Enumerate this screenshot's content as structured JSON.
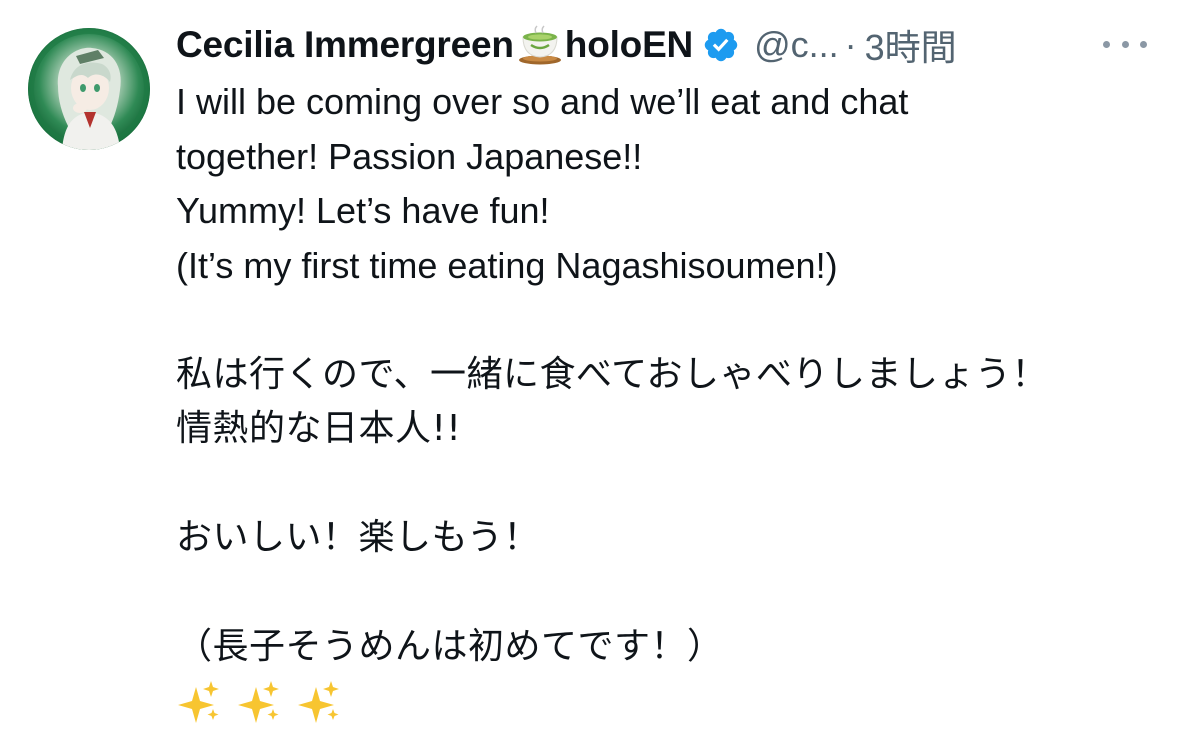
{
  "author": {
    "display_name": "Cecilia Immergreen",
    "name_suffix": "holoEN",
    "name_emoji": "tea-icon",
    "verified": true,
    "verified_color": "#1d9bf0",
    "handle": "@c...",
    "separator": "·",
    "timestamp": "3時間"
  },
  "tweet": {
    "lines": [
      "I will be coming over so and we’ll eat and chat",
      "together! Passion Japanese!!",
      "Yummy! Let’s have fun!",
      "(It’s my first time eating Nagashisoumen!)",
      "",
      "私は行くので、一緒に食べておしゃべりしましょう！",
      "情熱的な日本人!!",
      "",
      "おいしい！楽しもう！",
      "",
      "（長子そうめんは初めてです！）"
    ],
    "emoji_row": [
      "sparkles-icon",
      "sparkles-icon",
      "sparkles-icon"
    ]
  },
  "colors": {
    "text": "#0f1419",
    "secondary": "#536471",
    "accent": "#1d9bf0"
  }
}
